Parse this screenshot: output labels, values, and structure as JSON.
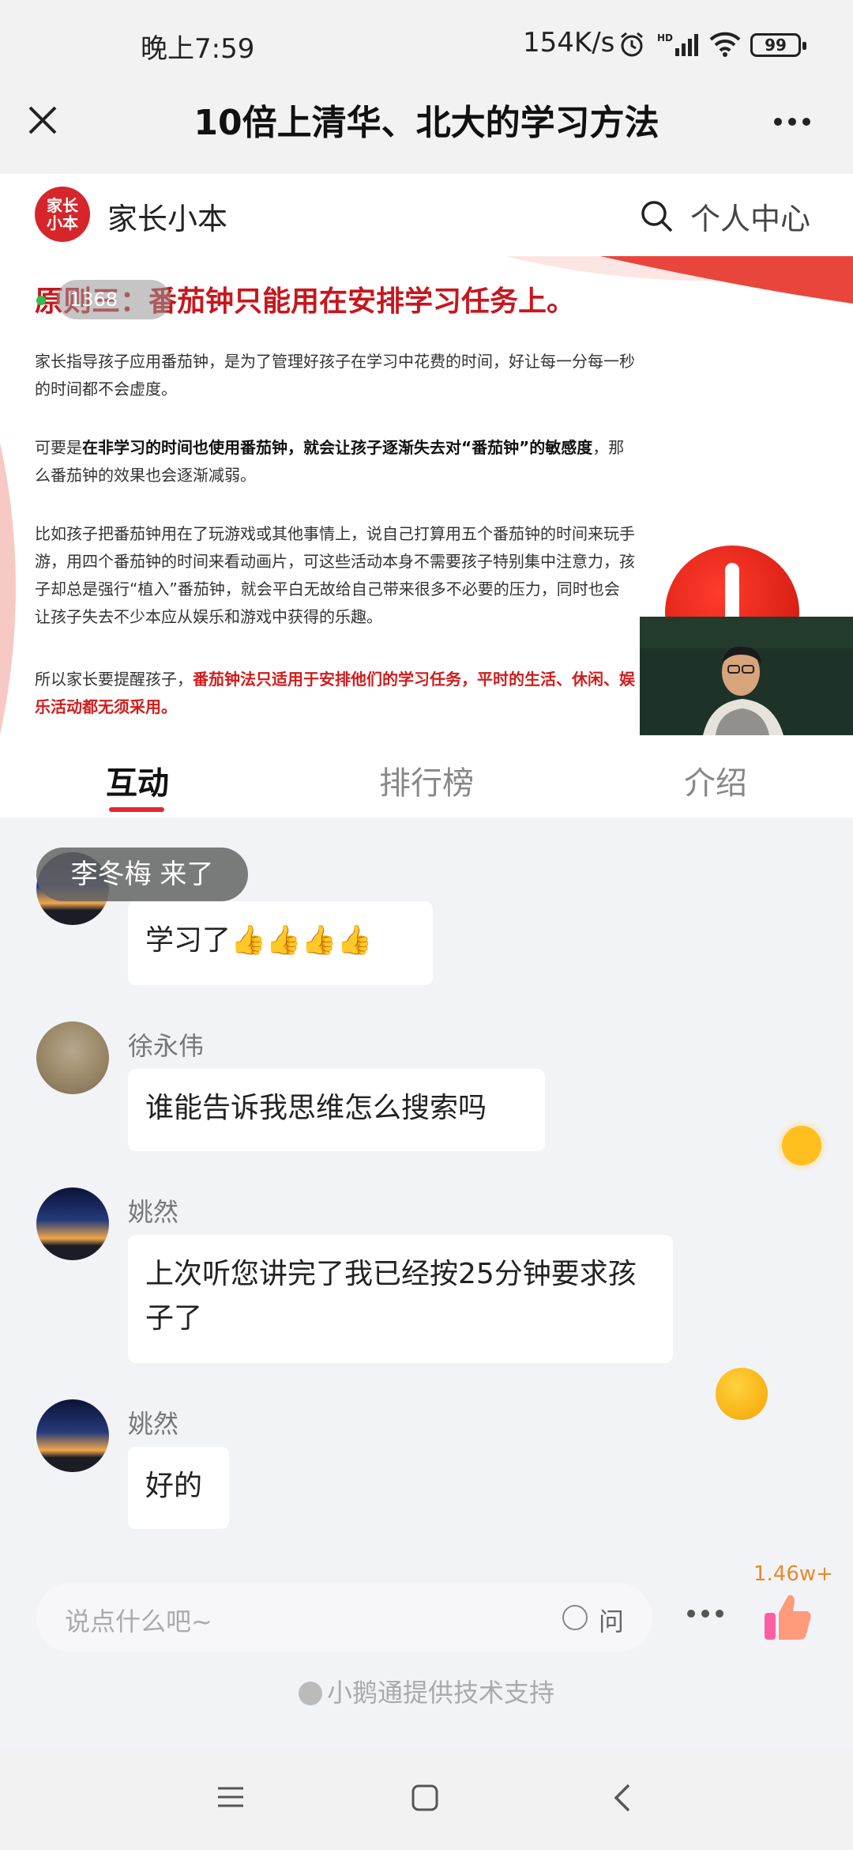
{
  "status_bar": {
    "time": "晚上7:59",
    "net_speed": "154K/s",
    "hd_label": "HD",
    "battery": "99"
  },
  "title_bar": {
    "title": "10倍上清华、北大的学习方法"
  },
  "brand": {
    "logo_text": "家长小本",
    "name": "家长小本",
    "user_center": "个人中心"
  },
  "slide": {
    "heading": "原则三：番茄钟只能用在安排学习任务上。",
    "live_badge": "1368",
    "p1": "家长指导孩子应用番茄钟，是为了管理好孩子在学习中花费的时间，好让每一分每一秒的时间都不会虚度。",
    "p2_prefix": "可要是",
    "p2_bold": "在非学习的时间也使用番茄钟，就会让孩子逐渐失去对“番茄钟”的敏感度",
    "p2_suffix": "，那么番茄钟的效果也会逐渐减弱。",
    "p3": "比如孩子把番茄钟用在了玩游戏或其他事情上，说自己打算用五个番茄钟的时间来玩手游，用四个番茄钟的时间来看动画片，可这些活动本身不需要孩子特别集中注意力，孩子却总是强行“植入”番茄钟，就会平白无故给自己带来很多不必要的压力，同时也会让孩子失去不少本应从娱乐和游戏中获得的乐趣。",
    "p4_prefix": "所以家长要提醒孩子，",
    "p4_red": "番茄钟法只适用于安排他们的学习任务，平时的生活、休闲、娱乐活动都无须采用。"
  },
  "tabs": [
    "互动",
    "排行榜",
    "介绍"
  ],
  "toast": "李冬梅 来了",
  "messages": [
    {
      "user": "",
      "text": "学习了👍👍👍👍"
    },
    {
      "user": "徐永伟",
      "text": "谁能告诉我思维怎么搜索吗"
    },
    {
      "user": "姚然",
      "text": "上次听您讲完了我已经按25分钟要求孩子了"
    },
    {
      "user": "姚然",
      "text": "好的"
    }
  ],
  "input": {
    "placeholder": "说点什么吧~",
    "ask_label": "问"
  },
  "likes": "1.46w+",
  "powered_by": "小鹅通提供技术支持",
  "colors": {
    "accent": "#e8262e",
    "brand_red": "#d6262b",
    "like_orange": "#e88a2a"
  }
}
